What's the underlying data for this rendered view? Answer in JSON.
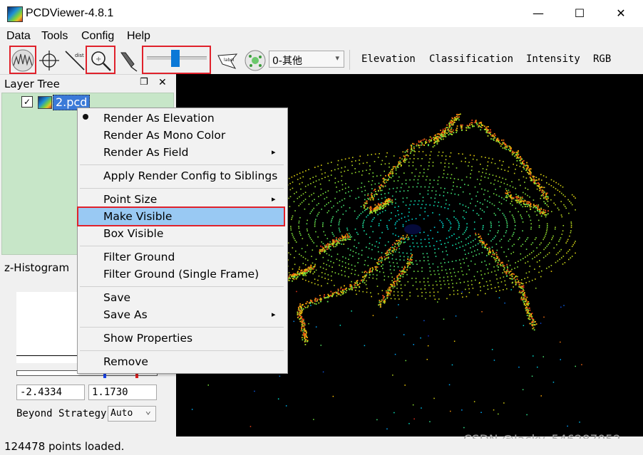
{
  "window": {
    "title": "PCDViewer-4.8.1",
    "minimize": "—",
    "maximize": "☐",
    "close": "✕"
  },
  "menus": [
    "Data",
    "Tools",
    "Config",
    "Help"
  ],
  "toolbar": {
    "icons": [
      "surface-tool-icon",
      "crosshair-icon",
      "distance-icon",
      "zoom-icon",
      "pick-tool-icon",
      "label-icon",
      "ground-icon"
    ],
    "combo_value": "0-其他",
    "combo_arrow": "▾",
    "modes": [
      "Elevation",
      "Classification",
      "Intensity",
      "RGB"
    ]
  },
  "layer_tree": {
    "title": "Layer Tree",
    "dock_icon": "❐",
    "close_icon": "✕",
    "item_label": "2.pcd",
    "checked": "✓"
  },
  "histogram": {
    "title": "z-Histogram",
    "min_value": "-2.4334",
    "max_value": "1.1730",
    "beyond_label": "Beyond Strategy",
    "beyond_value": "Auto",
    "beyond_arrow": "⌄"
  },
  "context_menu": {
    "items": [
      "Render As Elevation",
      "Render As Mono Color",
      "Render As Field",
      "Apply Render Config to Siblings",
      "Point Size",
      "Make Visible",
      "Box Visible",
      "Filter Ground",
      "Filter Ground (Single Frame)",
      "Save",
      "Save As",
      "Show Properties",
      "Remove"
    ],
    "submenu_arrow": "▸"
  },
  "status": "124478 points loaded.",
  "watermark": "CSDN @Jacky_546287052",
  "colors": {
    "highlight": "#99c9f3",
    "annotation_red": "#e0212b",
    "tree_bg": "#c7e6c8",
    "slider": "#0a78d7"
  }
}
